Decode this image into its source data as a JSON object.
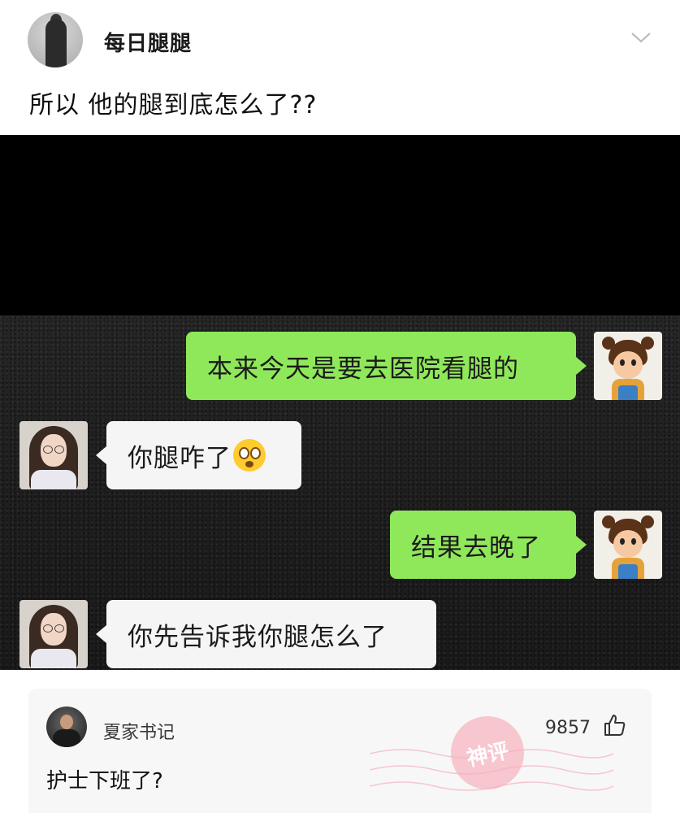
{
  "post": {
    "username": "每日腿腿",
    "text": "所以 他的腿到底怎么了??"
  },
  "chat": {
    "messages": [
      {
        "side": "right",
        "text": "本来今天是要去医院看腿的"
      },
      {
        "side": "left",
        "text": "你腿咋了"
      },
      {
        "side": "right",
        "text": "结果去晚了"
      },
      {
        "side": "left",
        "text": "你先告诉我你腿怎么了"
      }
    ]
  },
  "comment": {
    "username": "夏家书记",
    "likes": "9857",
    "text": "护士下班了?",
    "badge": "神评"
  },
  "colors": {
    "green_bubble": "#8fe85a",
    "white_bubble": "#f5f5f5",
    "stamp": "#f7b0be"
  },
  "icons": {
    "more": "chevron-down-icon",
    "like": "thumbs-up-icon",
    "reaction": "drooling-face-emoji"
  }
}
